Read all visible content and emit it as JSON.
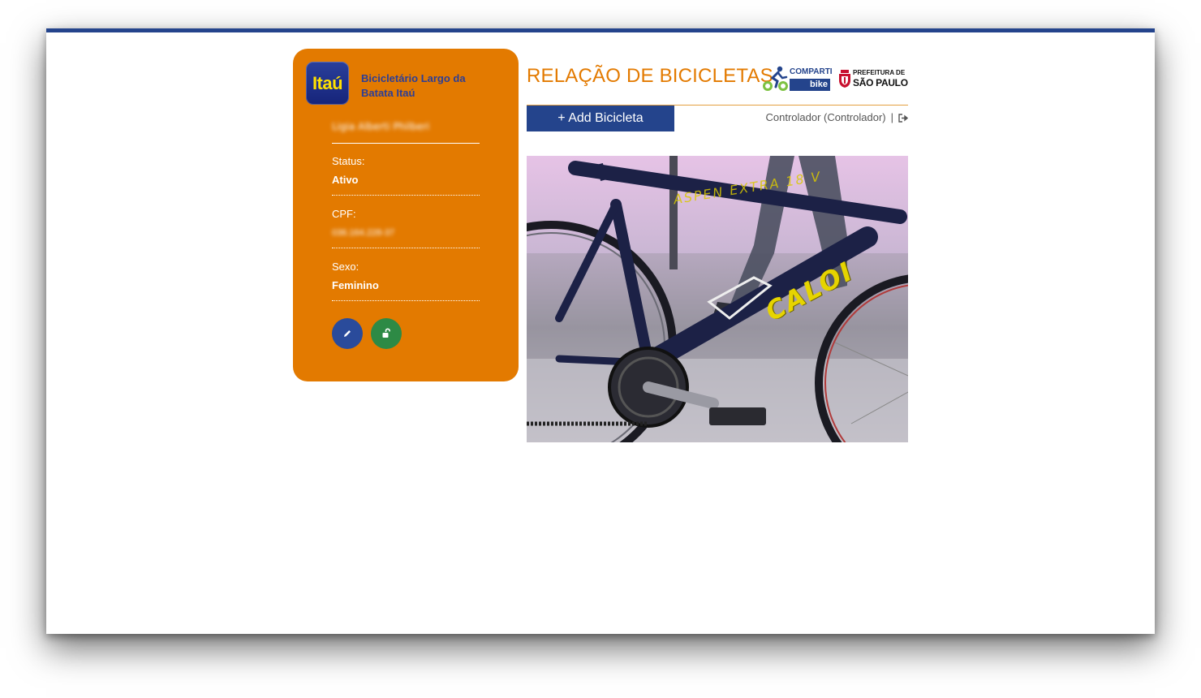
{
  "card": {
    "logo_text": "Itaú",
    "station_name": "Bicicletário Largo da Batata Itaú",
    "user_name": "Ligia Alberti Philberi",
    "fields": [
      {
        "label": "Status:",
        "value": "Ativo"
      },
      {
        "label": "CPF:",
        "value": "036.164.228-37"
      },
      {
        "label": "Sexo:",
        "value": "Feminino"
      }
    ]
  },
  "header": {
    "title": "RELAÇÃO DE BICICLETAS",
    "partner1_top": "COMPARTI",
    "partner1_bottom": "bike",
    "partner2_line1": "PREFEITURA DE",
    "partner2_line2": "SÃO PAULO"
  },
  "toolbar": {
    "add_label": "+ Add Bicicleta",
    "user_label": "Controlador (Controlador)",
    "separator": "|"
  },
  "photo": {
    "caption": "ASPEN EXTRA 18 V",
    "brand": "CALOI"
  },
  "colors": {
    "accent": "#e37a00",
    "primary": "#24448c",
    "success": "#2d8a45"
  }
}
